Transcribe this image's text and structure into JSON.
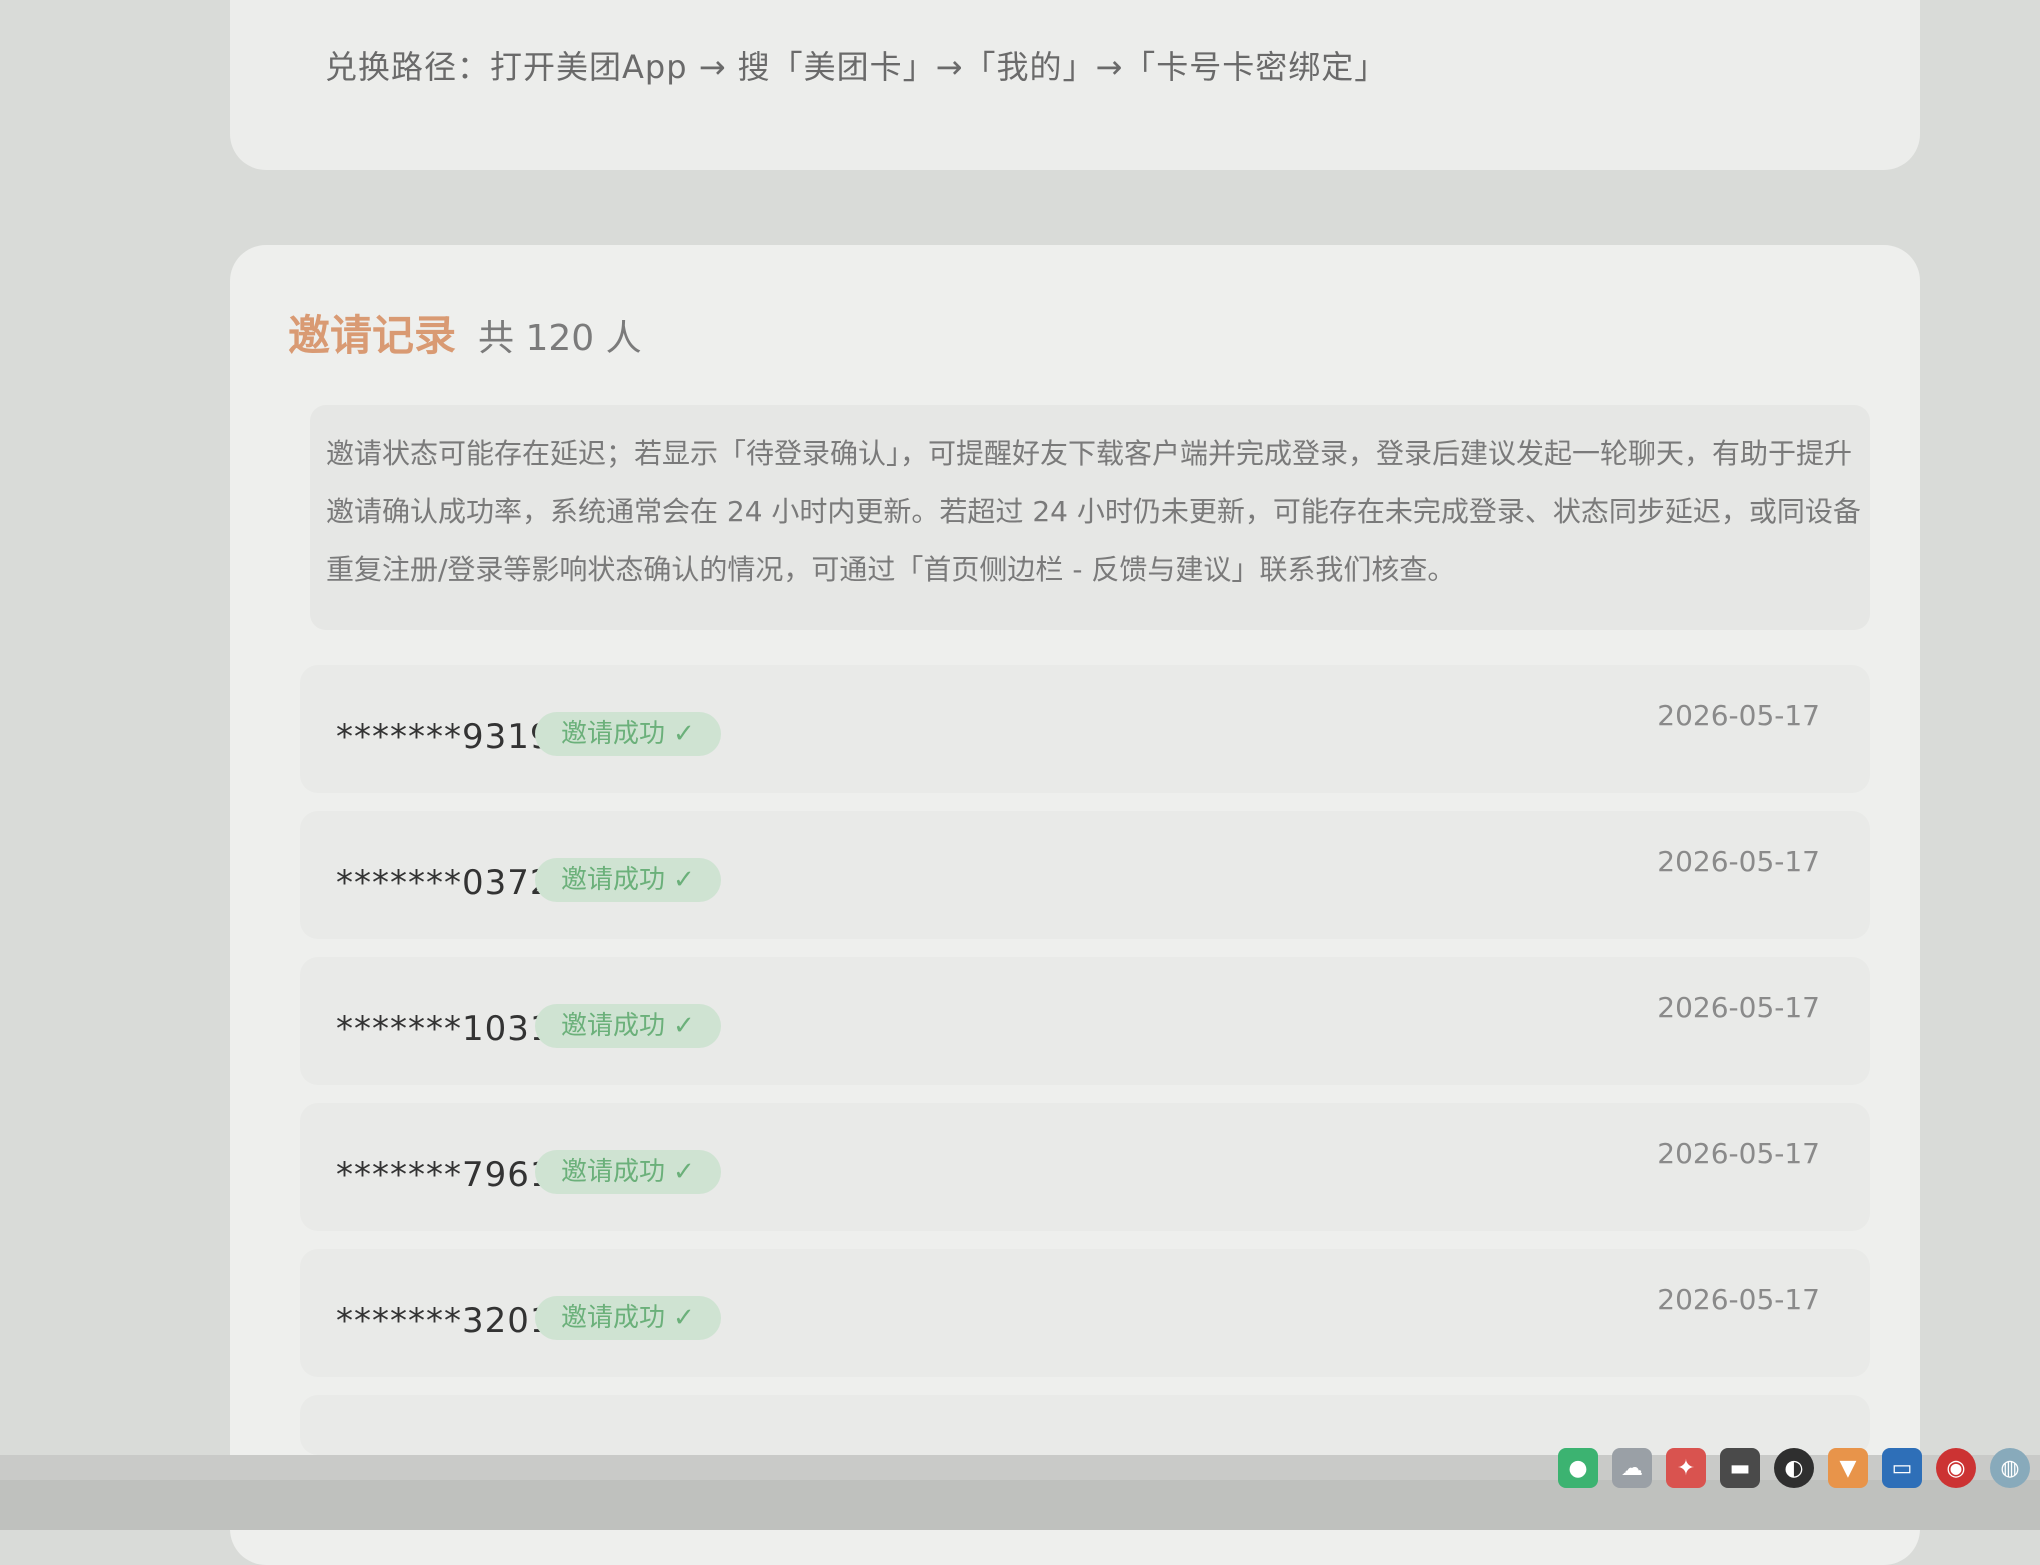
{
  "redeem": {
    "path_text": "兑换路径：打开美团App → 搜「美团卡」→「我的」→「卡号卡密绑定」"
  },
  "invite_section": {
    "title": "邀请记录",
    "count_text": "共 120 人",
    "notice": "邀请状态可能存在延迟；若显示「待登录确认」，可提醒好友下载客户端并完成登录，登录后建议发起一轮聊天，有助于提升邀请确认成功率，系统通常会在 24 小时内更新。若超过 24 小时仍未更新，可能存在未完成登录、状态同步延迟，或同设备重复注册/登录等影响状态确认的情况，可通过「首页侧边栏 - 反馈与建议」联系我们核查。",
    "records": [
      {
        "phone": "*******9319",
        "status": "邀请成功",
        "date": "2026-05-17"
      },
      {
        "phone": "*******0372",
        "status": "邀请成功",
        "date": "2026-05-17"
      },
      {
        "phone": "*******1031",
        "status": "邀请成功",
        "date": "2026-05-17"
      },
      {
        "phone": "*******7961",
        "status": "邀请成功",
        "date": "2026-05-17"
      },
      {
        "phone": "*******3201",
        "status": "邀请成功",
        "date": "2026-05-17"
      }
    ]
  },
  "colors": {
    "title_accent": "#d99a73",
    "badge_bg": "#cfe3d2",
    "badge_text": "#6bb07a"
  },
  "taskbar": {
    "icons": [
      "wechat-icon",
      "cloud-icon",
      "app-icon",
      "folder-icon",
      "browser-icon",
      "shield-icon",
      "window-icon",
      "record-icon",
      "network-icon"
    ]
  }
}
